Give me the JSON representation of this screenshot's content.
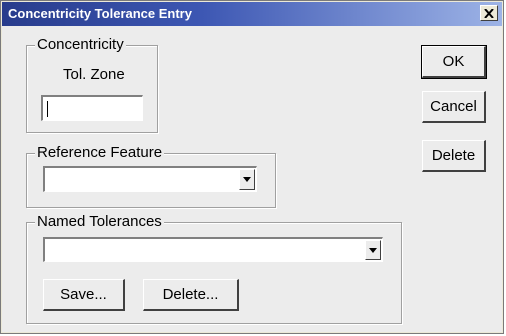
{
  "window": {
    "title": "Concentricity Tolerance Entry",
    "close_glyph": "✕"
  },
  "concentricity_group": {
    "legend": "Concentricity",
    "tol_zone_label": "Tol. Zone",
    "tol_zone_value": ""
  },
  "reference_feature_group": {
    "legend": "Reference Feature",
    "selected": ""
  },
  "named_tolerances_group": {
    "legend": "Named Tolerances",
    "selected": "",
    "save_label": "Save...",
    "delete_label": "Delete..."
  },
  "buttons": {
    "ok_label": "OK",
    "cancel_label": "Cancel",
    "delete_label": "Delete"
  },
  "icons": {
    "close": "close-icon",
    "dropdown": "dropdown-arrow-icon"
  }
}
